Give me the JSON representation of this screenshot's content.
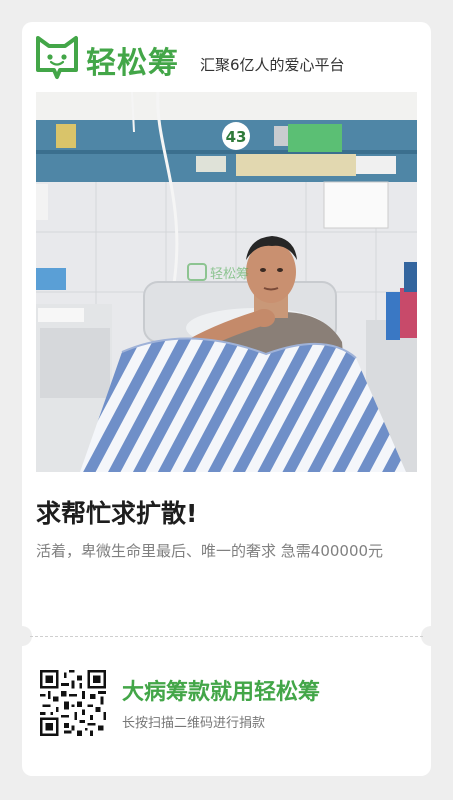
{
  "header": {
    "brand_name": "轻松筹",
    "slogan": "汇聚6亿人的爱心平台",
    "logo_icon": "cat-face-icon"
  },
  "photo": {
    "bed_number": "43",
    "watermark": "轻松筹"
  },
  "campaign": {
    "title": "求帮忙求扩散!",
    "description": "活着，卑微生命里最后、唯一的奢求  急需400000元"
  },
  "footer": {
    "cta_title": "大病筹款就用轻松筹",
    "cta_subtitle": "长按扫描二维码进行捐款"
  },
  "colors": {
    "brand_green": "#43a648",
    "background": "#eeeeee"
  }
}
